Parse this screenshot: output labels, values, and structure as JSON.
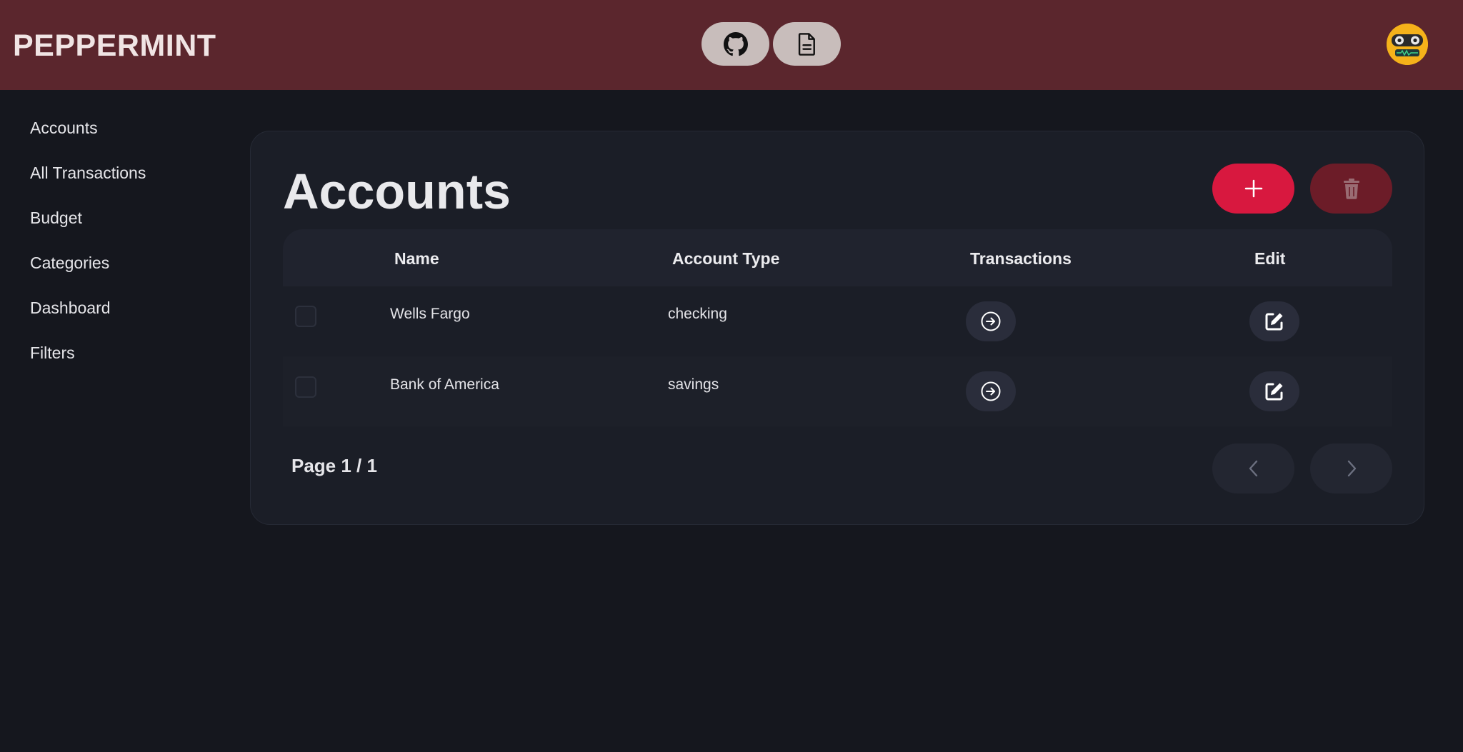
{
  "app": {
    "brand": "PEPPERMINT"
  },
  "header": {
    "github_icon": "github-icon",
    "docs_icon": "document-icon",
    "avatar_icon": "robot-avatar"
  },
  "sidebar": {
    "items": [
      {
        "label": "Accounts"
      },
      {
        "label": "All Transactions"
      },
      {
        "label": "Budget"
      },
      {
        "label": "Categories"
      },
      {
        "label": "Dashboard"
      },
      {
        "label": "Filters"
      }
    ]
  },
  "main": {
    "title": "Accounts",
    "add_icon": "plus-icon",
    "delete_icon": "trash-icon",
    "table": {
      "columns": [
        "Name",
        "Account Type",
        "Transactions",
        "Edit"
      ],
      "rows": [
        {
          "name": "Wells Fargo",
          "type": "checking"
        },
        {
          "name": "Bank of America",
          "type": "savings"
        }
      ]
    },
    "pagination": {
      "label": "Page 1 / 1",
      "prev_icon": "chevron-left-icon",
      "next_icon": "chevron-right-icon"
    }
  },
  "colors": {
    "topbar": "#5b262d",
    "background": "#15171e",
    "accent": "#d8183f",
    "danger_muted": "#6c1c28"
  }
}
